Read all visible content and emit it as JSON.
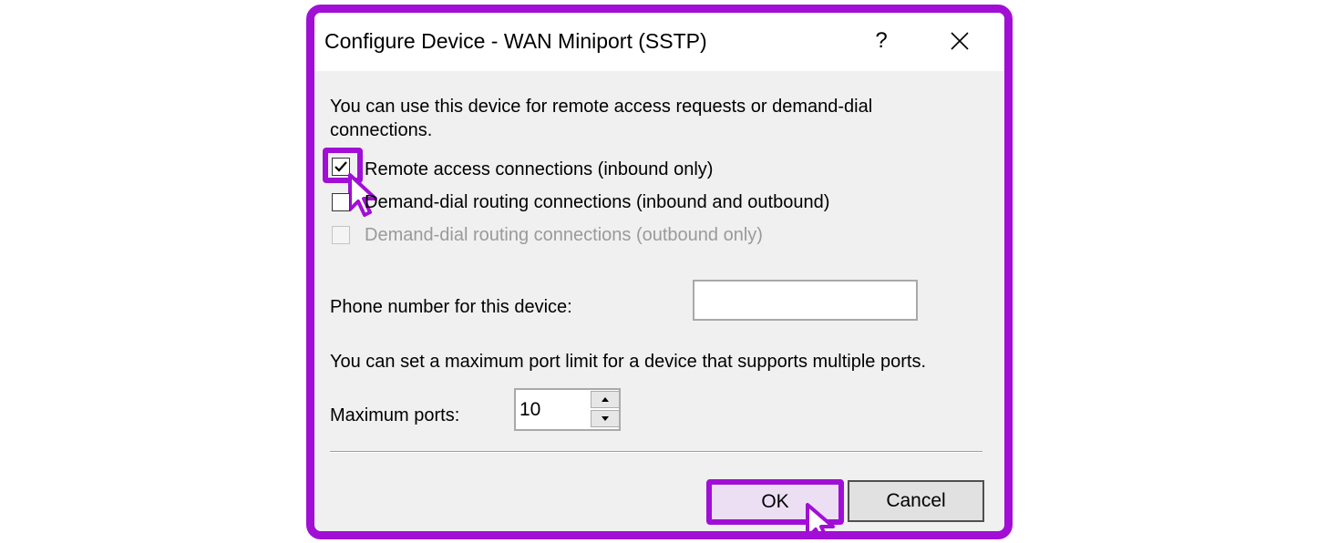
{
  "dialog": {
    "title": "Configure Device - WAN Miniport (SSTP)",
    "help_label": "?",
    "close_icon": "close-icon"
  },
  "intro_text": "You can use this device for remote access requests or demand-dial connections.",
  "options": [
    {
      "label": "Remote access connections (inbound only)",
      "checked": true,
      "enabled": true
    },
    {
      "label": "Demand-dial routing connections (inbound and outbound)",
      "checked": false,
      "enabled": true
    },
    {
      "label": "Demand-dial routing connections (outbound only)",
      "checked": false,
      "enabled": false
    }
  ],
  "phone": {
    "label": "Phone number for this device:",
    "value": ""
  },
  "ports_info": "You can set a maximum port limit for a device that supports multiple ports.",
  "max_ports": {
    "label": "Maximum ports:",
    "value": "10"
  },
  "buttons": {
    "ok": "OK",
    "cancel": "Cancel"
  },
  "colors": {
    "highlight": "#a10fd6",
    "dialog_bg": "#f0f0f0",
    "titlebar_bg": "#ffffff"
  }
}
